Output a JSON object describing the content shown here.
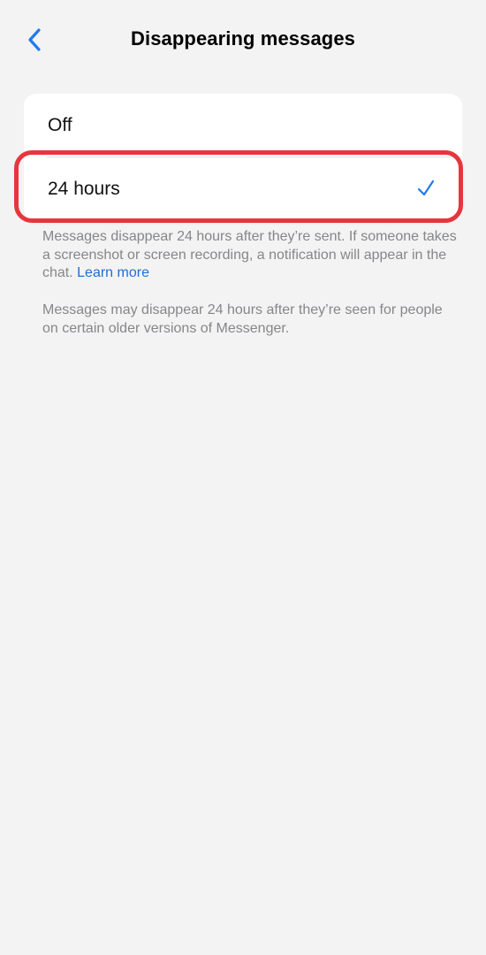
{
  "header": {
    "title": "Disappearing messages",
    "back_icon": "chevron-left-icon",
    "accent_color": "#1f7aec"
  },
  "options": [
    {
      "label": "Off",
      "selected": false
    },
    {
      "label": "24 hours",
      "selected": true
    }
  ],
  "checkmark_icon": "checkmark-icon",
  "highlight_color": "#e6363d",
  "description": {
    "text": "Messages disappear 24 hours after they’re sent. If someone takes a screenshot or screen recording, a notification will appear in the chat.",
    "link": "Learn more"
  },
  "note": "Messages may disappear 24 hours after they’re seen for people on certain older versions of Messenger."
}
